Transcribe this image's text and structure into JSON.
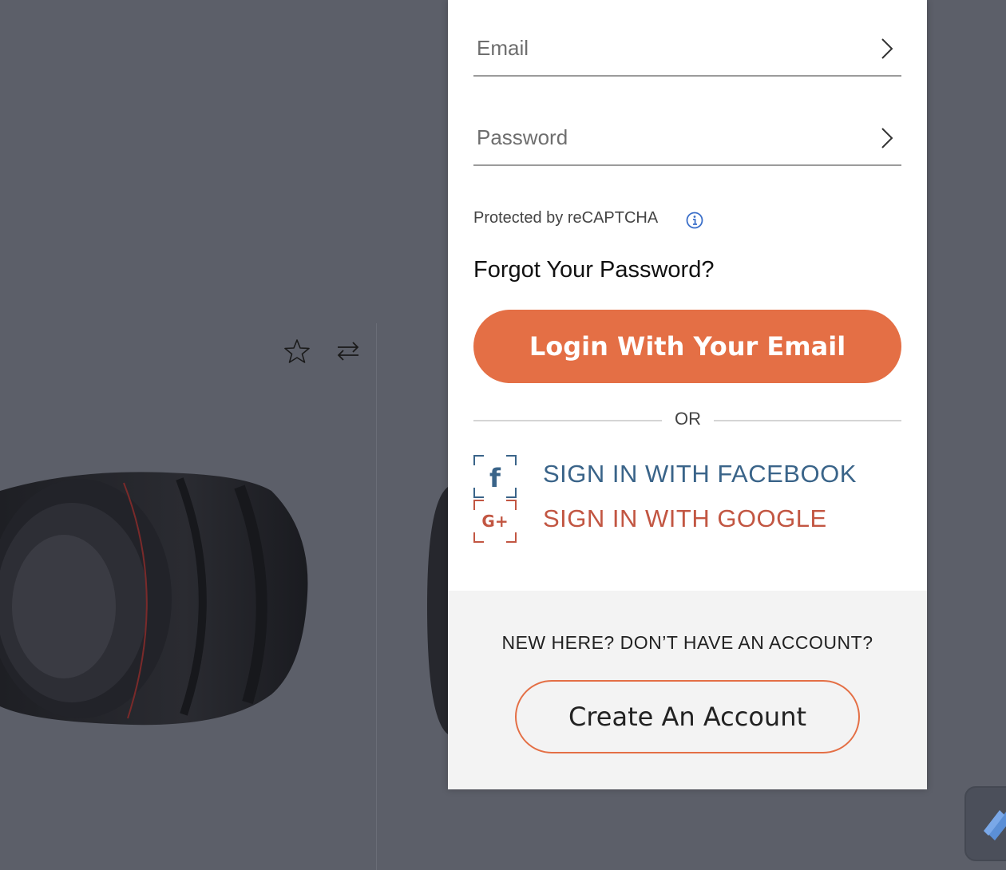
{
  "background": {
    "icons": {
      "favorite": "star-icon",
      "compare": "compare-arrows-icon"
    }
  },
  "login_form": {
    "email_placeholder": "Email",
    "password_placeholder": "Password",
    "recaptcha_text": "Protected by reCAPTCHA",
    "forgot_password": "Forgot Your Password?",
    "login_button": "Login With Your Email",
    "or_text": "OR",
    "facebook_label": "SIGN IN WITH FACEBOOK",
    "google_label": "SIGN IN WITH GOOGLE",
    "facebook_icon_glyph": "f",
    "google_icon_glyph": "G+"
  },
  "signup": {
    "prompt": "NEW HERE? DON’T HAVE AN ACCOUNT?",
    "button": "Create An Account"
  },
  "colors": {
    "accent": "#e46f45",
    "facebook": "#3a6489",
    "google": "#c25642",
    "overlay": "#5c5f69"
  }
}
